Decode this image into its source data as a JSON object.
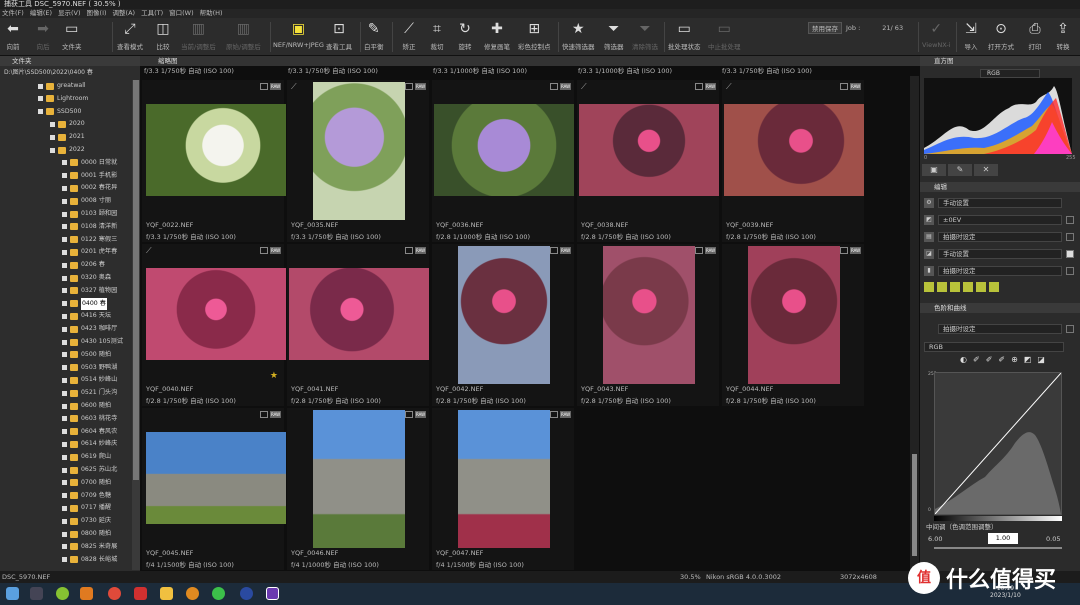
{
  "window_title": "捕获工具    DSC_5970.NEF ( 30.5% )",
  "menu": [
    "文件(F)",
    "编辑(E)",
    "显示(V)",
    "图像(I)",
    "调整(A)",
    "工具(T)",
    "窗口(W)",
    "帮助(H)"
  ],
  "toolbar": {
    "back": "向前",
    "forward": "向后",
    "folder": "文件夹",
    "view_mode": "查看模式",
    "compare": "比较",
    "current_before": "当前/调整后",
    "orig_after": "原始/调整后",
    "nef_format": "NEF/NRW+JPEG",
    "view_tools": "查看工具",
    "wb": "白平衡",
    "straighten": "矫正",
    "crop": "裁切",
    "rotate": "旋转",
    "retouch": "修复画笔",
    "color_ctrl": "彩色控制点",
    "quick_filter": "快速筛选器",
    "filter": "筛选器",
    "clear_filter": "清除筛选",
    "batch_status": "批处理状态",
    "stop_batch": "中止批处理",
    "viewnx": "ViewNX-i",
    "import": "导入",
    "open_with": "打开方式",
    "print": "打印",
    "convert": "转换",
    "save_label": "禁用保存",
    "job_label": "Job :",
    "job_count": "21/  63"
  },
  "left_panel": {
    "header": "文件夹",
    "path": "D:\\图片\\SSD500\\2022\\0400 春",
    "items": [
      {
        "label": "greatwall",
        "level": 2
      },
      {
        "label": "Lightroom",
        "level": 2
      },
      {
        "label": "SSD500",
        "level": 2
      },
      {
        "label": "2020",
        "level": 3
      },
      {
        "label": "2021",
        "level": 3
      },
      {
        "label": "2022",
        "level": 3
      },
      {
        "label": "0000 日常就",
        "level": 4
      },
      {
        "label": "0001 手机影",
        "level": 4
      },
      {
        "label": "0002 春花异",
        "level": 4
      },
      {
        "label": "0008 寸丽",
        "level": 4
      },
      {
        "label": "0103 颐和园",
        "level": 4
      },
      {
        "label": "0108 清洋新",
        "level": 4
      },
      {
        "label": "0122 寒假三",
        "level": 4
      },
      {
        "label": "0201 虎年春",
        "level": 4
      },
      {
        "label": "0206 春",
        "level": 4
      },
      {
        "label": "0320 奥森",
        "level": 4
      },
      {
        "label": "0327 植物园",
        "level": 4
      },
      {
        "label": "0400 春",
        "level": 4,
        "selected": true
      },
      {
        "label": "0416 天坛",
        "level": 4
      },
      {
        "label": "0423 咖啡厅",
        "level": 4
      },
      {
        "label": "0430 105测试",
        "level": 4
      },
      {
        "label": "0500 随拍",
        "level": 4
      },
      {
        "label": "0503 野鸭湖",
        "level": 4
      },
      {
        "label": "0514 妙峰山",
        "level": 4
      },
      {
        "label": "0521 门头沟",
        "level": 4
      },
      {
        "label": "0600 随拍",
        "level": 4
      },
      {
        "label": "0603 桃花寺",
        "level": 4
      },
      {
        "label": "0604 春风农",
        "level": 4
      },
      {
        "label": "0614 妙峰庆",
        "level": 4
      },
      {
        "label": "0619 爬山",
        "level": 4
      },
      {
        "label": "0625 苏山北",
        "level": 4
      },
      {
        "label": "0700 随拍",
        "level": 4
      },
      {
        "label": "0709 色糖",
        "level": 4
      },
      {
        "label": "0717 播醒",
        "level": 4
      },
      {
        "label": "0730 延庆",
        "level": 4
      },
      {
        "label": "0800 随拍",
        "level": 4
      },
      {
        "label": "0825 米奇展",
        "level": 4
      },
      {
        "label": "0828 长峪城",
        "level": 4
      }
    ]
  },
  "center": {
    "header": "缩略图",
    "prev_row": [
      "f/3.3 1/750秒 自动 (ISO 100)",
      "f/3.3 1/750秒 自动 (ISO 100)",
      "f/3.3 1/1000秒 自动 (ISO 100)",
      "f/3.3 1/1000秒 自动 (ISO 100)",
      "f/3.3 1/750秒 自动 (ISO 100)"
    ],
    "thumbs": [
      {
        "file": "YQF_0022.NEF",
        "exif": "f/3.3 1/750秒 自动 (ISO 100)"
      },
      {
        "file": "YQF_0035.NEF",
        "exif": "f/3.3 1/750秒 自动 (ISO 100)"
      },
      {
        "file": "YQF_0036.NEF",
        "exif": "f/2.8 1/1000秒 自动 (ISO 100)"
      },
      {
        "file": "YQF_0038.NEF",
        "exif": "f/2.8 1/750秒 自动 (ISO 100)"
      },
      {
        "file": "YQF_0039.NEF",
        "exif": "f/2.8 1/750秒 自动 (ISO 100)"
      },
      {
        "file": "YQF_0040.NEF",
        "exif": "f/2.8 1/750秒 自动 (ISO 100)"
      },
      {
        "file": "YQF_0041.NEF",
        "exif": "f/2.8 1/750秒 自动 (ISO 100)"
      },
      {
        "file": "YQF_0042.NEF",
        "exif": "f/2.8 1/750秒 自动 (ISO 100)"
      },
      {
        "file": "YQF_0043.NEF",
        "exif": "f/2.8 1/750秒 自动 (ISO 100)"
      },
      {
        "file": "YQF_0044.NEF",
        "exif": "f/2.8 1/750秒 自动 (ISO 100)"
      },
      {
        "file": "YQF_0045.NEF",
        "exif": "f/4 1/1500秒 自动 (ISO 100)"
      },
      {
        "file": "YQF_0046.NEF",
        "exif": "f/4 1/1000秒 自动 (ISO 100)"
      },
      {
        "file": "YQF_0047.NEF",
        "exif": "f/4 1/1500秒 自动 (ISO 100)"
      }
    ],
    "raw_badge": "RAW"
  },
  "right_panel": {
    "histogram_header": "直方图",
    "histogram_channel": "RGB",
    "hist_min": "0",
    "hist_max": "255",
    "edit_header": "编辑",
    "edit_rows": [
      "手动设置",
      "±0EV",
      "拍摄时设定",
      "手动设置",
      "拍摄时设定"
    ],
    "levels_header": "色阶和曲线",
    "levels_preset": "拍摄时设定",
    "levels_channel": "RGB",
    "curve_top": "255",
    "curve_bottom": "0",
    "midtone_label": "中间调（色调范围调整）",
    "midtone_left": "6.00",
    "midtone_value": "1.00",
    "midtone_right": "0.05"
  },
  "status": {
    "file": "DSC_5970.NEF",
    "zoom": "30.5%",
    "profile": "Nikon sRGB 4.0.0.3002",
    "size": "3072x4608"
  },
  "taskbar": {
    "time": "10:19",
    "date": "2023/1/10"
  },
  "watermark": "什么值得买",
  "watermark_icon": "值"
}
